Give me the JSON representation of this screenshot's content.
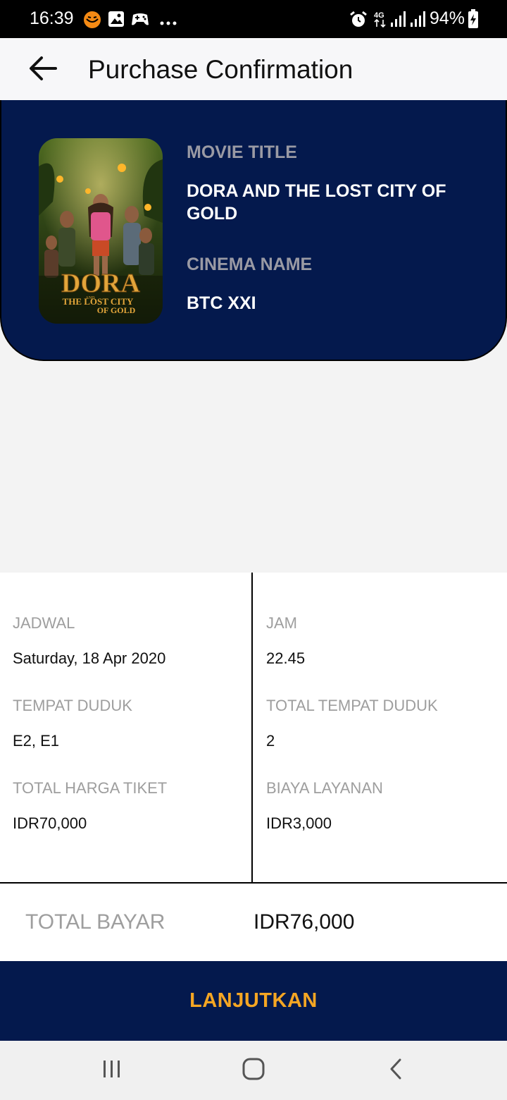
{
  "status_bar": {
    "time": "16:39",
    "battery": "94%",
    "network": "4G",
    "icons": [
      "app-notification-icon",
      "image-icon",
      "game-controller-icon",
      "more-dots-icon",
      "alarm-icon",
      "network-4g-icon",
      "signal-icon",
      "signal-icon",
      "battery-charging-icon"
    ]
  },
  "app_bar": {
    "title": "Purchase Confirmation",
    "back_icon": "back-arrow-icon"
  },
  "movie": {
    "title_label": "MOVIE TITLE",
    "title": "DORA AND THE LOST CITY OF GOLD",
    "cinema_label": "CINEMA NAME",
    "cinema": "BTC XXI",
    "poster": {
      "logo": "DORA",
      "small": "AND",
      "sub1": "THE LOST CITY",
      "sub2": "OF GOLD"
    }
  },
  "details": {
    "schedule_label": "JADWAL",
    "schedule": "Saturday, 18 Apr 2020",
    "time_label": "JAM",
    "time": "22.45",
    "seats_label": "TEMPAT DUDUK",
    "seats": "E2, E1",
    "total_seats_label": "TOTAL TEMPAT DUDUK",
    "total_seats": "2",
    "ticket_total_label": "TOTAL HARGA TIKET",
    "ticket_total": "IDR70,000",
    "service_fee_label": "BIAYA LAYANAN",
    "service_fee": "IDR3,000"
  },
  "total": {
    "label": "TOTAL BAYAR",
    "value": "IDR76,000"
  },
  "action": {
    "continue_label": "LANJUTKAN"
  },
  "nav_bar": {
    "icons": [
      "recent-apps-icon",
      "home-icon",
      "back-icon"
    ]
  },
  "colors": {
    "primary": "#04194d",
    "accent": "#f5a623",
    "label_gray": "#9e9e9e"
  }
}
